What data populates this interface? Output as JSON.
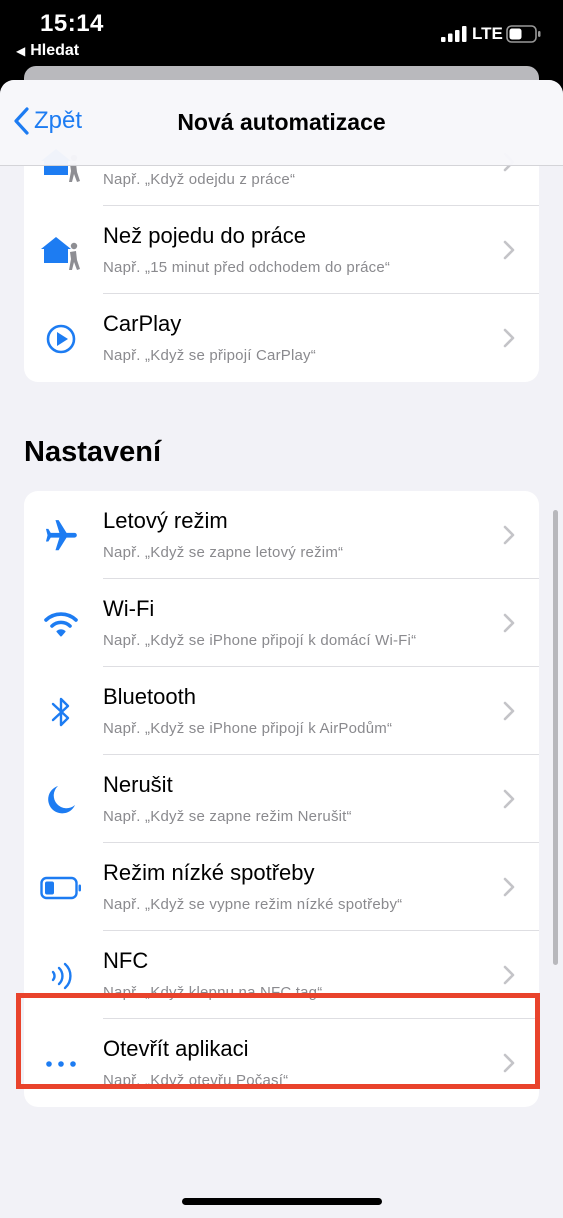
{
  "status": {
    "time": "15:14",
    "back_app": "Hledat",
    "network": "LTE"
  },
  "nav": {
    "back_label": "Zpět",
    "title": "Nová automatizace"
  },
  "travel_items": [
    {
      "title": "",
      "subtitle": "Např. „Když odejdu z práce“",
      "icon": "home-person-icon"
    },
    {
      "title": "Než pojedu do práce",
      "subtitle": "Např. „15 minut před odchodem do práce“",
      "icon": "home-person-icon"
    },
    {
      "title": "CarPlay",
      "subtitle": "Např. „Když se připojí CarPlay“",
      "icon": "carplay-icon"
    }
  ],
  "section_title": "Nastavení",
  "settings_items": [
    {
      "title": "Letový režim",
      "subtitle": "Např. „Když se zapne letový režim“",
      "icon": "airplane-icon"
    },
    {
      "title": "Wi-Fi",
      "subtitle": "Např. „Když se iPhone připojí k domácí Wi-Fi“",
      "icon": "wifi-icon"
    },
    {
      "title": "Bluetooth",
      "subtitle": "Např. „Když se iPhone připojí k AirPodům“",
      "icon": "bluetooth-icon"
    },
    {
      "title": "Nerušit",
      "subtitle": "Např. „Když se zapne režim Nerušit“",
      "icon": "moon-icon"
    },
    {
      "title": "Režim nízké spotřeby",
      "subtitle": "Např. „Když se vypne režim nízké spotřeby“",
      "icon": "battery-low-icon"
    },
    {
      "title": "NFC",
      "subtitle": "Např. „Když klepnu na NFC tag“",
      "icon": "nfc-icon"
    },
    {
      "title": "Otevřít aplikaci",
      "subtitle": "Např. „Když otevřu Počasí“",
      "icon": "ellipsis-icon"
    }
  ],
  "colors": {
    "accent": "#1d7cf2",
    "highlight": "#e9432c",
    "background": "#f2f2f7"
  }
}
